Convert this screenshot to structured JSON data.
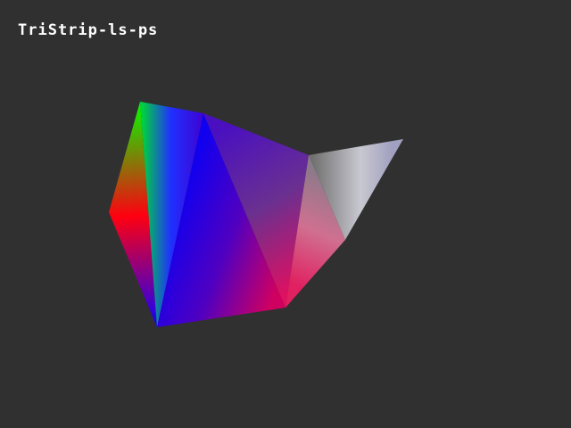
{
  "title": "TriStrip-ls-ps",
  "colors": {
    "background": "#303030",
    "green": "#00ff00",
    "red": "#ff0000",
    "blue": "#0000ff",
    "purple": "#4000c0",
    "magenta": "#d00060",
    "white": "#e0e0e0",
    "lavender": "#9090b0"
  }
}
